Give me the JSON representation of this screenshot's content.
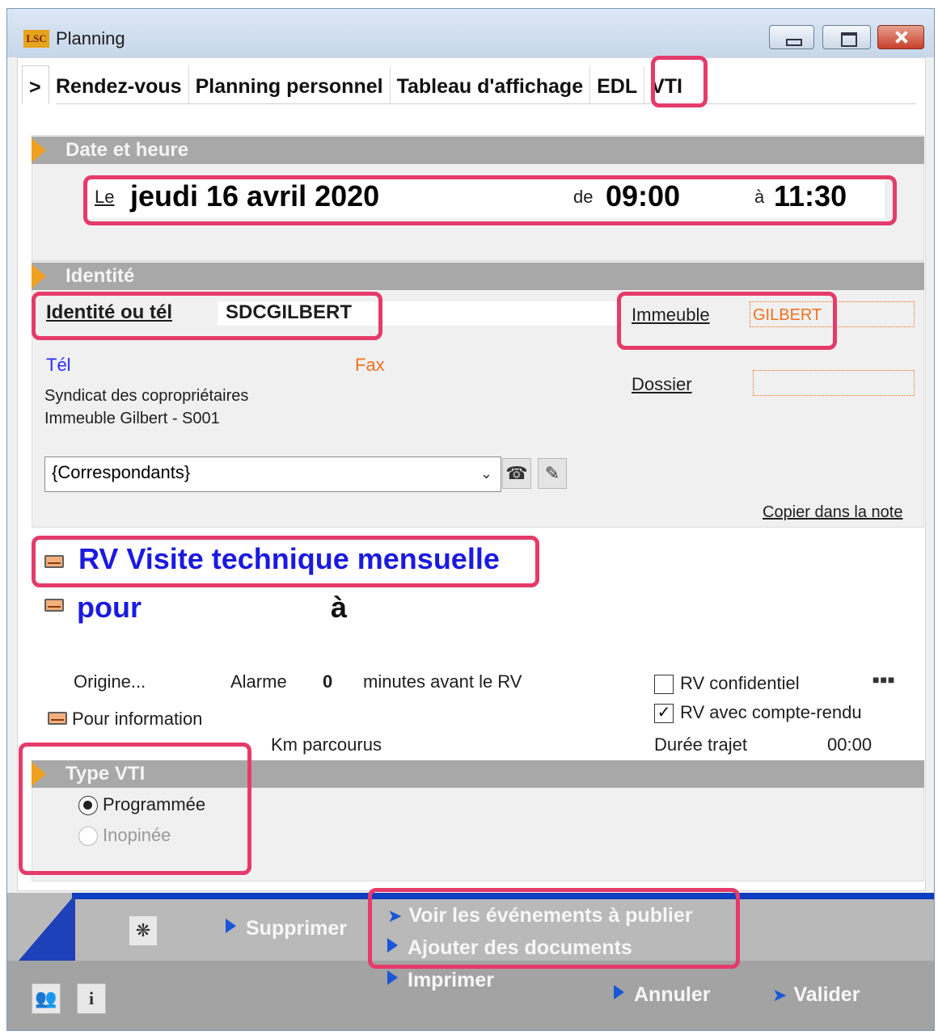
{
  "window": {
    "title": "Planning",
    "logo": "LSC"
  },
  "tabs": [
    ">",
    "Rendez-vous",
    "Planning personnel",
    "Tableau d'affichage",
    "EDL",
    "VTI"
  ],
  "date_section": {
    "header": "Date et heure",
    "le_label": "Le",
    "date": "jeudi 16 avril 2020",
    "de_label": "de",
    "start": "09:00",
    "a_label": "à",
    "end": "11:30"
  },
  "identity_section": {
    "header": "Identité",
    "identity_label": "Identité ou tél",
    "identity_value": "SDCGILBERT",
    "immeuble_label": "Immeuble",
    "immeuble_value": "GILBERT",
    "tel_label": "Tél",
    "fax_label": "Fax",
    "dossier_label": "Dossier",
    "address_line1": "Syndicat des copropriétaires",
    "address_line2": "Immeuble Gilbert - S001",
    "correspondants": "{Correspondants}",
    "copy_link": "Copier dans la note"
  },
  "rv": {
    "title": "RV Visite technique mensuelle",
    "pour_label": "pour",
    "a_label": "à"
  },
  "options": {
    "origine": "Origine...",
    "alarme_label": "Alarme",
    "alarme_value": "0",
    "minutes_label": "minutes avant le RV",
    "confidentiel_label": "RV confidentiel",
    "compte_rendu_label": "RV avec compte-rendu",
    "pour_info": "Pour information",
    "km_label": "Km parcourus",
    "duree_label": "Durée trajet",
    "duree_value": "00:00",
    "dots": "■■■"
  },
  "type_section": {
    "header": "Type VTI",
    "opt1": "Programmée",
    "opt2": "Inopinée"
  },
  "actions": {
    "supprimer": "Supprimer",
    "voir": "Voir les événements à publier",
    "ajouter": "Ajouter des documents",
    "imprimer": "Imprimer",
    "annuler": "Annuler",
    "valider": "Valider"
  },
  "colors": {
    "highlight": "#e53b6a",
    "blue_title": "#1a1ae0",
    "orange": "#f07020"
  }
}
